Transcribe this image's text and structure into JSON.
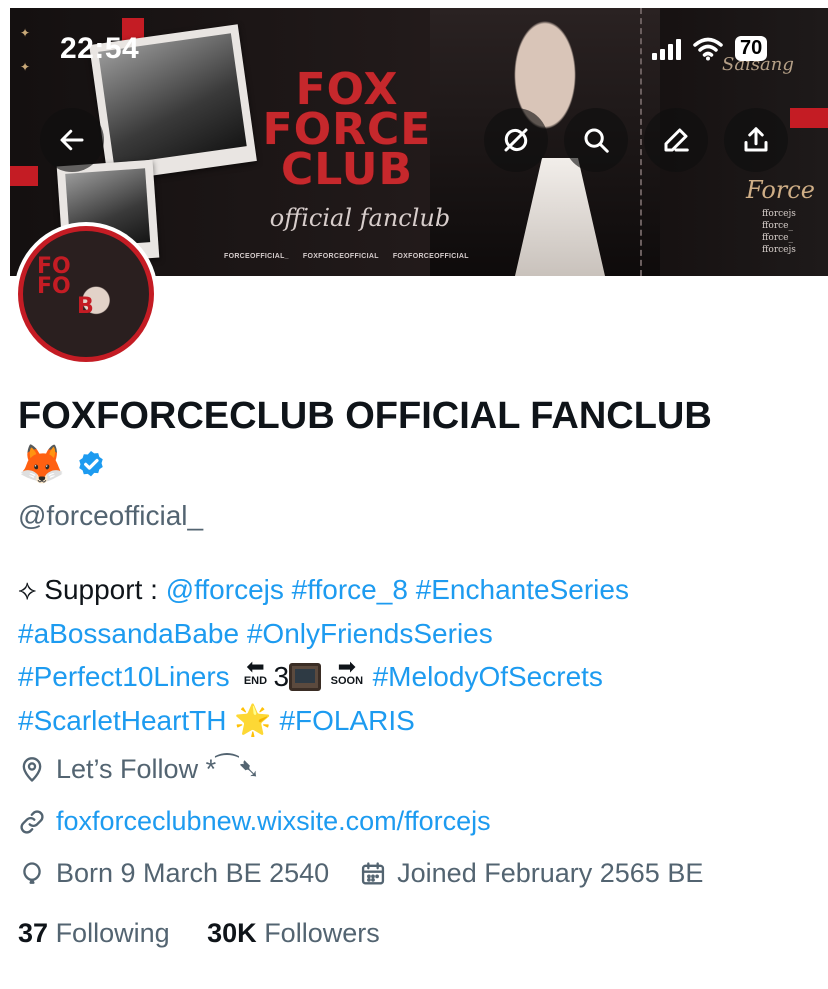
{
  "status_bar": {
    "time": "22:54",
    "battery": "70"
  },
  "banner": {
    "title_lines": [
      "FOX",
      "FORCE",
      "CLUB"
    ],
    "subtitle": "official fanclub",
    "handles": [
      "FORCEOFFICIAL_",
      "FOXFORCEOFFICIAL",
      "FOXFORCEOFFICIAL"
    ],
    "script_top": "Saisang",
    "side_word": "Force",
    "side_list": [
      "fforcejs",
      "fforce_",
      "fforce_",
      "fforcejs"
    ]
  },
  "avatar": {
    "text_lines": [
      "FO",
      "FO",
      "B"
    ]
  },
  "profile": {
    "name": "FOXFORCECLUB OFFICIAL FANCLUB🦊",
    "handle": "@forceofficial_",
    "bio": {
      "prefix": "⟡ Support : ",
      "mention": "@fforcejs",
      "tag_fforce": "#fforce_8",
      "tag_enchante": "#EnchanteSeries",
      "tag_bossanda": "#aBossandaBabe",
      "tag_onlyfriends": "#OnlyFriendsSeries",
      "tag_perfect10": "#Perfect10Liners",
      "end_label": "END",
      "num_3": "3",
      "soon_label": "SOON",
      "tag_melody": "#MelodyOfSecrets",
      "tag_scarlet": "#ScarletHeartTH",
      "star": "🌟",
      "tag_folaris": "#FOLARIS"
    },
    "location": "Let’s Follow *⁀➷",
    "website": "foxforceclubnew.wixsite.com/fforcejs",
    "birthday": "Born 9 March BE 2540",
    "joined": "Joined February 2565 BE",
    "following_count": "37",
    "following_label": "Following",
    "followers_count": "30K",
    "followers_label": "Followers"
  },
  "colors": {
    "accent_blue": "#1d9bf0",
    "brand_red": "#c41c24",
    "secondary_text": "#536471"
  }
}
